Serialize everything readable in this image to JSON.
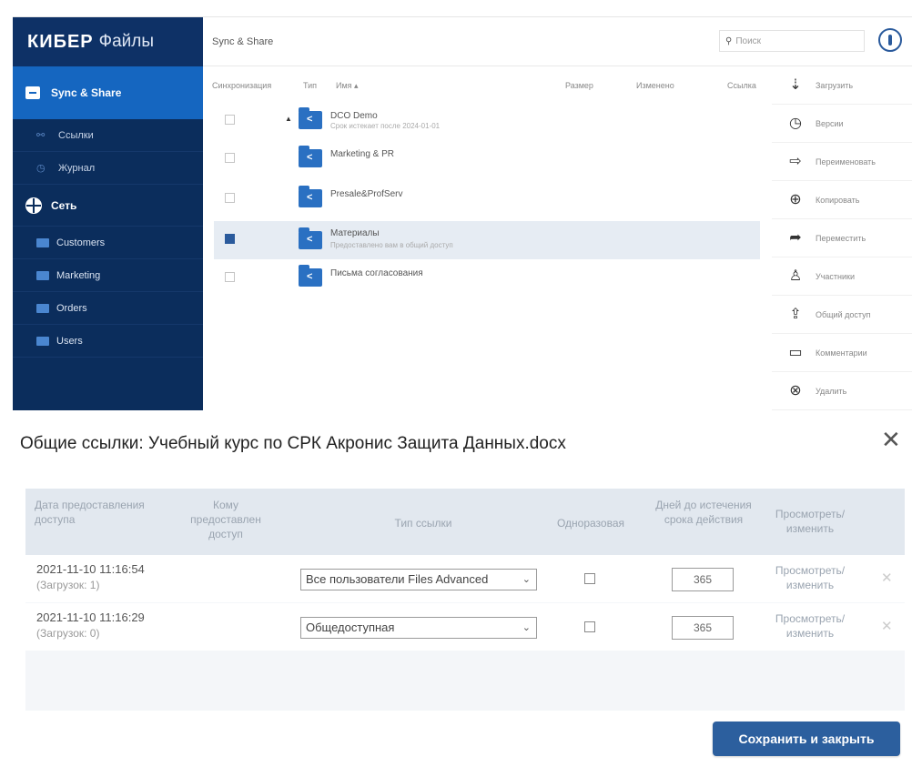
{
  "brand": {
    "bold": "КИБЕР",
    "light": "Файлы"
  },
  "sidebar": {
    "active_item": "Sync & Share",
    "sub_items": [
      "Ссылки",
      "Журнал"
    ],
    "network_label": "Сеть",
    "folders": [
      "Customers",
      "Marketing",
      "Orders",
      "Users"
    ]
  },
  "header": {
    "breadcrumb": "Sync & Share",
    "search_placeholder": "Поиск"
  },
  "file_table": {
    "columns": [
      "Синхронизация",
      "Тип",
      "Имя ▴",
      "Размер",
      "Изменено",
      "Ссылка"
    ],
    "rows": [
      {
        "name": "DCO Demo",
        "sub": "Срок истекает после 2024-01-01"
      },
      {
        "name": "Marketing & PR",
        "sub": ""
      },
      {
        "name": "Presale&ProfServ",
        "sub": ""
      },
      {
        "name": "Материалы",
        "sub": "Предоставлено вам в общий доступ",
        "selected": true
      },
      {
        "name": "Письма согласования",
        "sub": ""
      }
    ]
  },
  "actions": [
    "Загрузить",
    "Версии",
    "Переименовать",
    "Копировать",
    "Переместить",
    "Участники",
    "Общий доступ",
    "Комментарии",
    "Удалить"
  ],
  "dialog": {
    "title": "Общие ссылки: Учебный курс по СРК Акронис Защита Данных.docx",
    "headers": {
      "date": "Дата предоставления доступа",
      "to_whom": "Кому предоставлен доступ",
      "type": "Тип ссылки",
      "onetime": "Одноразовая",
      "days": "Дней до истечения срока действия",
      "view": "Просмотреть/ изменить"
    },
    "rows": [
      {
        "date": "2021-11-10 11:16:54",
        "downloads": "(Загрузок: 1)",
        "link_type": "Все пользователи Files Advanced",
        "days": "365",
        "view": "Просмотреть/ изменить"
      },
      {
        "date": "2021-11-10 11:16:29",
        "downloads": "(Загрузок: 0)",
        "link_type": "Общедоступная",
        "days": "365",
        "view": "Просмотреть/ изменить"
      }
    ],
    "save_label": "Сохранить и закрыть"
  }
}
